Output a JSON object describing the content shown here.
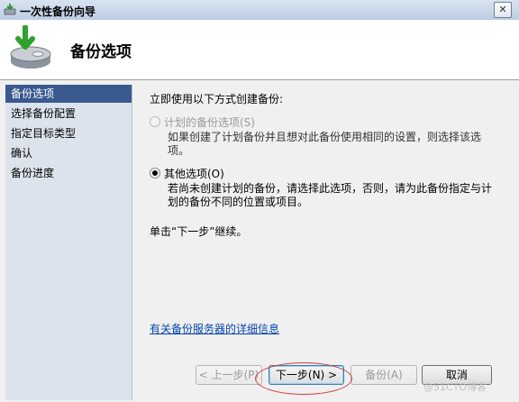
{
  "window": {
    "title": "一次性备份向导",
    "close_glyph": "✕"
  },
  "header": {
    "title": "备份选项"
  },
  "sidebar": {
    "items": [
      {
        "label": "备份选项",
        "active": true
      },
      {
        "label": "选择备份配置",
        "active": false
      },
      {
        "label": "指定目标类型",
        "active": false
      },
      {
        "label": "确认",
        "active": false
      },
      {
        "label": "备份进度",
        "active": false
      }
    ]
  },
  "main": {
    "prompt": "立即使用以下方式创建备份:",
    "options": [
      {
        "label": "计划的备份选项(S)",
        "checked": false,
        "enabled": false,
        "description": "如果创建了计划备份并且想对此备份使用相同的设置，则选择该选项。"
      },
      {
        "label": "其他选项(O)",
        "checked": true,
        "enabled": true,
        "description": "若尚未创建计划的备份，请选择此选项，否则，请为此备份指定与计划的备份不同的位置或项目。"
      }
    ],
    "next_note": "单击“下一步”继续。",
    "link_text": "有关备份服务器的详细信息"
  },
  "buttons": {
    "back": "< 上一步(P)",
    "next": "下一步(N) >",
    "backup": "备份(A)",
    "cancel": "取消"
  },
  "watermark": "@51CTO博客",
  "colors": {
    "sidebar_active": "#3a5a8f",
    "sidebar_bg": "#dde3ec",
    "link": "#0645ad",
    "highlight_oval": "#d43a3a"
  }
}
